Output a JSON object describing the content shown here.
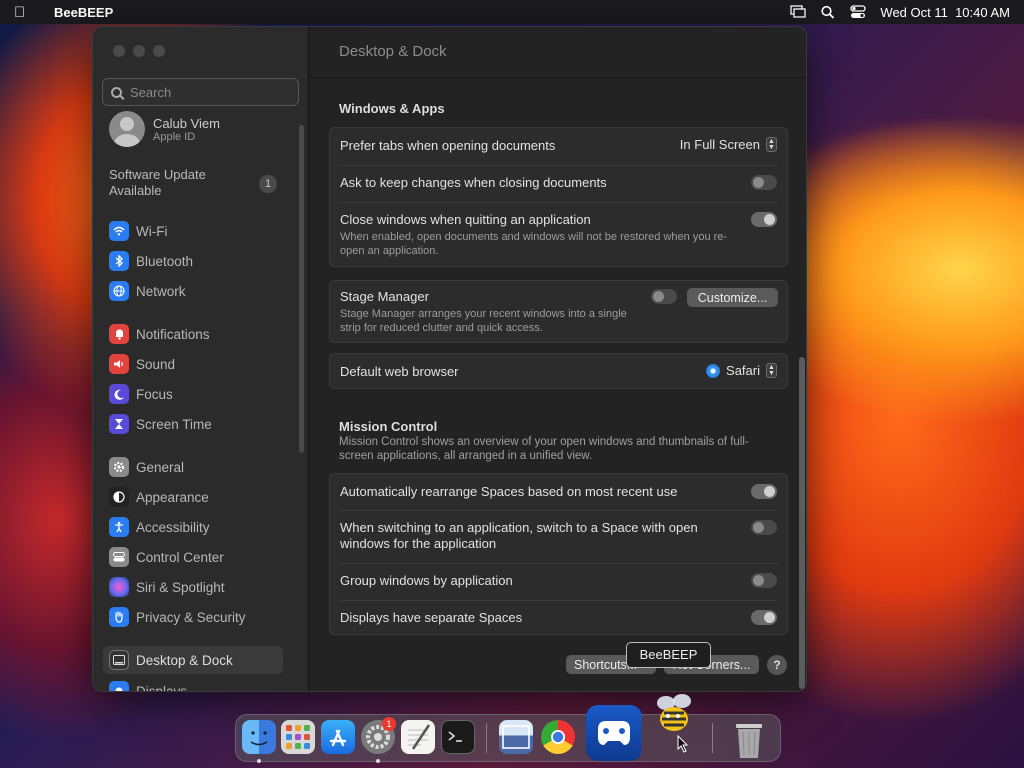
{
  "menubar": {
    "app_name": "BeeBEEP",
    "datetime": "Wed Oct 11  10:40 AM"
  },
  "search": {
    "placeholder": "Search"
  },
  "account": {
    "name": "Calub Viem",
    "subtitle": "Apple ID"
  },
  "software_update": {
    "label": "Software Update Available",
    "badge": "1"
  },
  "sidebar": {
    "items": [
      {
        "label": "Wi-Fi",
        "icon": "wifi-icon",
        "color": "#2a7cf0"
      },
      {
        "label": "Bluetooth",
        "icon": "bluetooth-icon",
        "color": "#2a7cf0"
      },
      {
        "label": "Network",
        "icon": "globe-icon",
        "color": "#2a7cf0"
      },
      {
        "label": "Notifications",
        "icon": "bell-icon",
        "color": "#e0443c"
      },
      {
        "label": "Sound",
        "icon": "speaker-icon",
        "color": "#e0443c"
      },
      {
        "label": "Focus",
        "icon": "moon-icon",
        "color": "#5a4ad8"
      },
      {
        "label": "Screen Time",
        "icon": "hourglass-icon",
        "color": "#5a4ad8"
      },
      {
        "label": "General",
        "icon": "gear-icon",
        "color": "#8a8a8a"
      },
      {
        "label": "Appearance",
        "icon": "appearance-icon",
        "color": "#222222"
      },
      {
        "label": "Accessibility",
        "icon": "accessibility-icon",
        "color": "#2a7cf0"
      },
      {
        "label": "Control Center",
        "icon": "control-center-icon",
        "color": "#8a8a8a"
      },
      {
        "label": "Siri & Spotlight",
        "icon": "siri-icon",
        "color": "#b04ad8"
      },
      {
        "label": "Privacy & Security",
        "icon": "hand-icon",
        "color": "#2a7cf0"
      },
      {
        "label": "Desktop & Dock",
        "icon": "desktop-icon",
        "color": "#333333"
      },
      {
        "label": "Displays",
        "icon": "display-icon",
        "color": "#2a7cf0"
      }
    ]
  },
  "content": {
    "title": "Desktop & Dock",
    "windows_apps": {
      "heading": "Windows & Apps",
      "prefer_tabs": {
        "label": "Prefer tabs when opening documents",
        "value": "In Full Screen"
      },
      "ask_keep": {
        "label": "Ask to keep changes when closing documents",
        "on": false
      },
      "close_windows": {
        "label": "Close windows when quitting an application",
        "desc": "When enabled, open documents and windows will not be restored when you re-open an application.",
        "on": true
      }
    },
    "stage_manager": {
      "label": "Stage Manager",
      "desc": "Stage Manager arranges your recent windows into a single strip for reduced clutter and quick access.",
      "on": false,
      "button": "Customize..."
    },
    "browser": {
      "label": "Default web browser",
      "value": "Safari"
    },
    "mission_control": {
      "heading": "Mission Control",
      "desc": "Mission Control shows an overview of your open windows and thumbnails of full-screen applications, all arranged in a unified view.",
      "auto_rearrange": {
        "label": "Automatically rearrange Spaces based on most recent use",
        "on": true
      },
      "switch_space": {
        "label": "When switching to an application, switch to a Space with open windows for the application",
        "on": false
      },
      "group_windows": {
        "label": "Group windows by application",
        "on": false
      },
      "separate_spaces": {
        "label": "Displays have separate Spaces",
        "on": true
      }
    },
    "shortcuts_button": "Shortcuts...",
    "hot_corners_button": "Hot Corners...",
    "help": "?"
  },
  "tooltip": "BeeBEEP",
  "dock": {
    "items": [
      "Finder",
      "Launchpad",
      "App Store",
      "System Settings",
      "TextEdit",
      "Terminal",
      "Preview",
      "Google Chrome",
      "Steam Link",
      "BeeBEEP",
      "Trash"
    ],
    "settings_badge": "1"
  }
}
